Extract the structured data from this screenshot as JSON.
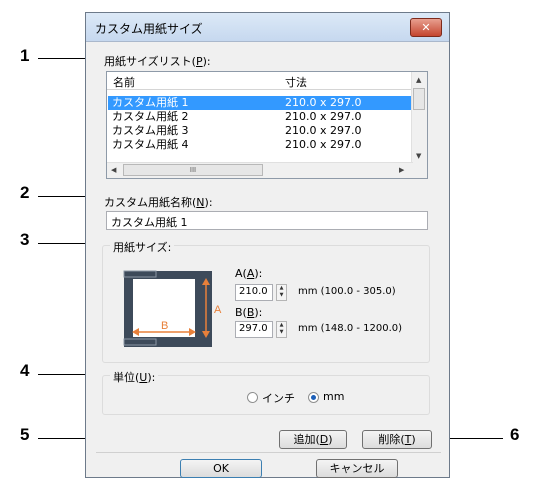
{
  "callouts": [
    "1",
    "2",
    "3",
    "4",
    "5",
    "6"
  ],
  "dialog": {
    "title": "カスタム用紙サイズ",
    "close_glyph": "✕"
  },
  "paper_list": {
    "label_main": "用紙サイズリスト(",
    "label_key": "P",
    "label_tail": "):",
    "col_name": "名前",
    "col_size": "寸法",
    "rows": [
      {
        "name": "カスタム用紙 1",
        "size": "210.0 x 297.0",
        "selected": true
      },
      {
        "name": "カスタム用紙 2",
        "size": "210.0 x 297.0",
        "selected": false
      },
      {
        "name": "カスタム用紙 3",
        "size": "210.0 x 297.0",
        "selected": false
      },
      {
        "name": "カスタム用紙 4",
        "size": "210.0 x 297.0",
        "selected": false
      }
    ],
    "hscroll_grip": "III"
  },
  "custom_name": {
    "label_main": "カスタム用紙名称(",
    "label_key": "N",
    "label_tail": "):",
    "value": "カスタム用紙 1"
  },
  "paper_size": {
    "label": "用紙サイズ:",
    "diagram_a": "A",
    "diagram_b": "B",
    "a_label_main": "A(",
    "a_label_key": "A",
    "a_label_tail": "):",
    "a_value": "210.0",
    "a_range": "mm (100.0 - 305.0)",
    "b_label_main": "B(",
    "b_label_key": "B",
    "b_label_tail": "):",
    "b_value": "297.0",
    "b_range": "mm (148.0 - 1200.0)"
  },
  "unit": {
    "label_main": "単位(",
    "label_key": "U",
    "label_tail": "):",
    "options": [
      "インチ",
      "mm"
    ],
    "selected": "mm"
  },
  "buttons": {
    "add_main": "追加(",
    "add_key": "D",
    "add_tail": ")",
    "delete_main": "削除(",
    "delete_key": "T",
    "delete_tail": ")",
    "ok": "OK",
    "cancel": "キャンセル"
  },
  "colors": {
    "selection": "#3399ff",
    "accent_orange": "#e8803a",
    "close_red": "#c4452f"
  }
}
